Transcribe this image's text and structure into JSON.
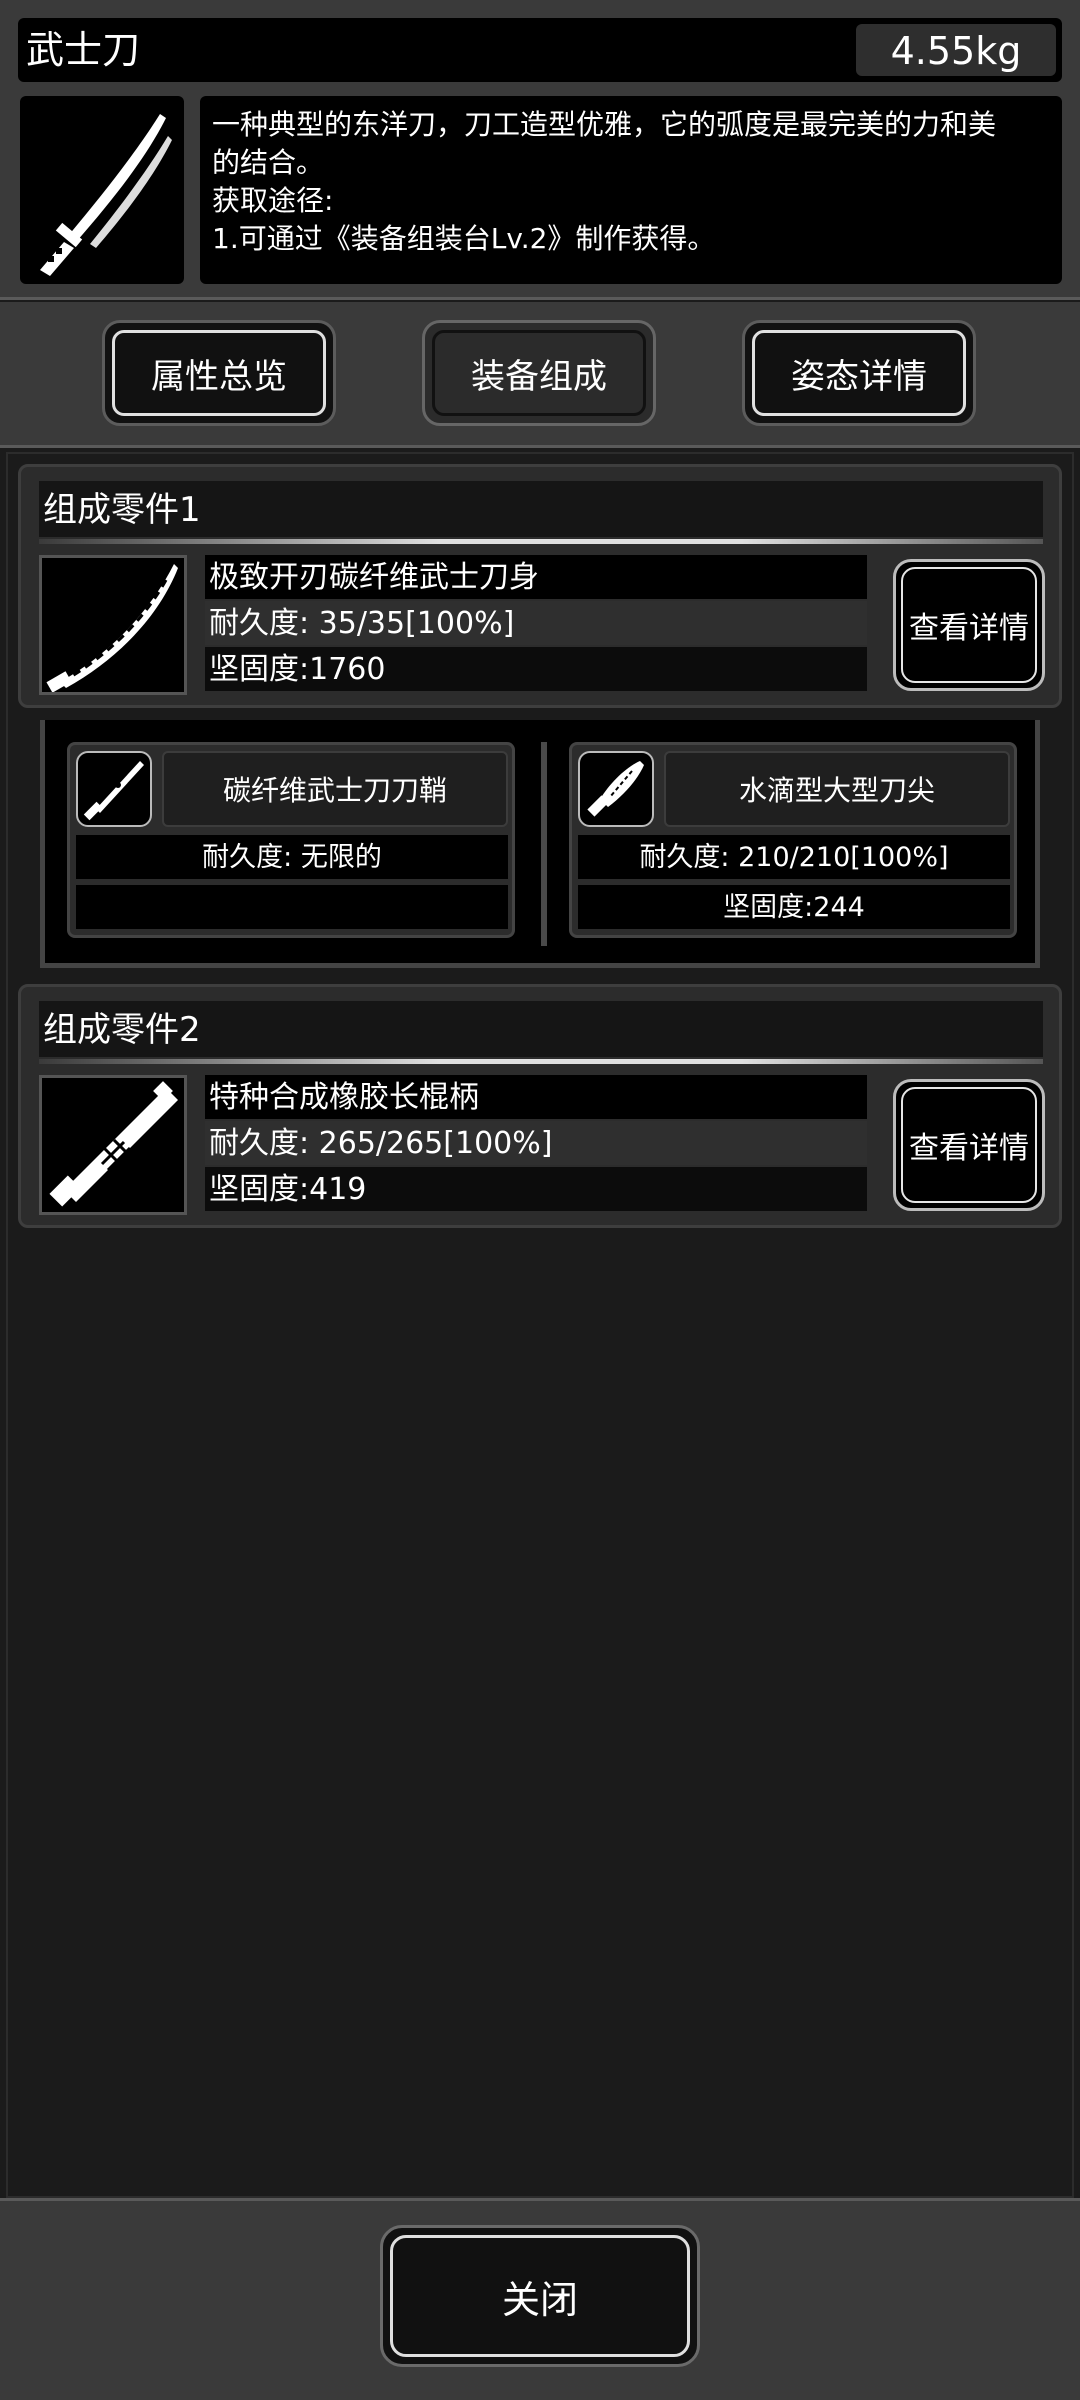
{
  "item": {
    "name": "武士刀",
    "weight": "4.55kg",
    "icon": "katana-icon",
    "description_lines": [
      "一种典型的东洋刀，刀工造型优雅，它的弧度是最完美的力和美",
      "的结合。",
      "获取途径:",
      "1.可通过《装备组装台Lv.2》制作获得。"
    ]
  },
  "tabs": [
    {
      "label": "属性总览",
      "active": false
    },
    {
      "label": "装备组成",
      "active": true
    },
    {
      "label": "姿态详情",
      "active": false
    }
  ],
  "parts": [
    {
      "title": "组成零件1",
      "name": "极致开刃碳纤维武士刀身",
      "durability": "耐久度: 35/35[100%]",
      "hardness": "坚固度:1760",
      "icon": "blade-icon",
      "detail_label": "查看详情"
    },
    {
      "title": "组成零件2",
      "name": "特种合成橡胶长棍柄",
      "durability": "耐久度: 265/265[100%]",
      "hardness": "坚固度:419",
      "icon": "handle-icon",
      "detail_label": "查看详情"
    }
  ],
  "subparts": [
    {
      "name": "碳纤维武士刀刀鞘",
      "durability": "耐久度: 无限的",
      "hardness": "",
      "icon": "scabbard-icon"
    },
    {
      "name": "水滴型大型刀尖",
      "durability": "耐久度: 210/210[100%]",
      "hardness": "坚固度:244",
      "icon": "blade-tip-icon"
    }
  ],
  "footer": {
    "close_label": "关闭"
  },
  "colors": {
    "background": "#1b1b1b",
    "panel": "#2c2c2c",
    "frame": "#3a3a3a",
    "text": "#ffffff"
  }
}
